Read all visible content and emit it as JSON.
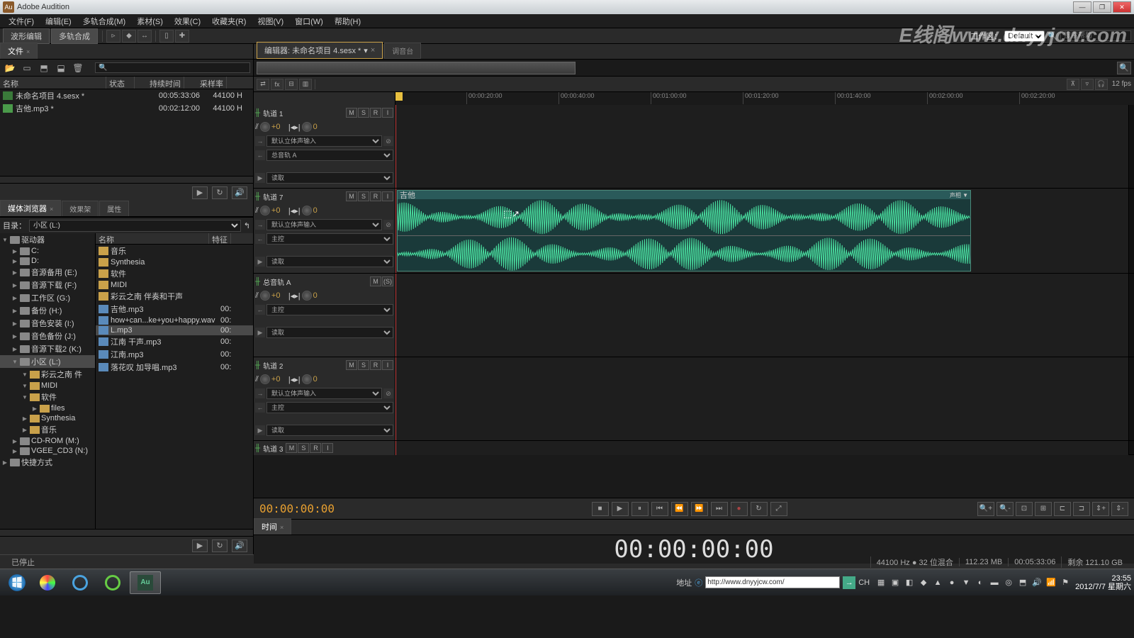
{
  "app": {
    "title": "Adobe Audition",
    "logo": "Au"
  },
  "menu": [
    "文件(F)",
    "编辑(E)",
    "多轨合成(M)",
    "素材(S)",
    "效果(C)",
    "收藏夹(R)",
    "视图(V)",
    "窗口(W)",
    "帮助(H)"
  ],
  "toolbar": {
    "modes": [
      "波形编辑",
      "多轨合成"
    ],
    "workspace_label": "工作区：",
    "workspace": "Default",
    "search_placeholder": "搜索帮助"
  },
  "watermark": "E线阁www.dnyyjcw.com",
  "files_panel": {
    "tab": "文件",
    "search_placeholder": "",
    "headers": {
      "name": "名称",
      "status": "状态",
      "duration": "持续时间",
      "rate": "采样率"
    },
    "rows": [
      {
        "name": "未命名项目 4.sesx *",
        "duration": "00:05:33:06",
        "rate": "44100 H"
      },
      {
        "name": "吉他.mp3 *",
        "duration": "00:02:12:00",
        "rate": "44100 H"
      }
    ]
  },
  "browser_panel": {
    "tabs": [
      "媒体浏览器",
      "效果架",
      "属性"
    ],
    "dir_label": "目录：",
    "dir": "小区 (L:)",
    "tree": [
      {
        "l": 0,
        "t": "drive",
        "n": "驱动器",
        "exp": true
      },
      {
        "l": 1,
        "t": "disk",
        "n": "C:"
      },
      {
        "l": 1,
        "t": "disk",
        "n": "D:"
      },
      {
        "l": 1,
        "t": "disk",
        "n": "音源备用 (E:)"
      },
      {
        "l": 1,
        "t": "disk",
        "n": "音源下载 (F:)"
      },
      {
        "l": 1,
        "t": "disk",
        "n": "工作区 (G:)"
      },
      {
        "l": 1,
        "t": "disk",
        "n": "备份 (H:)"
      },
      {
        "l": 1,
        "t": "disk",
        "n": "音色安装 (I:)"
      },
      {
        "l": 1,
        "t": "disk",
        "n": "音色备份 (J:)"
      },
      {
        "l": 1,
        "t": "disk",
        "n": "音源下载2 (K:)"
      },
      {
        "l": 1,
        "t": "disk",
        "n": "小区 (L:)",
        "exp": true,
        "sel": true
      },
      {
        "l": 2,
        "t": "folder",
        "n": "彩云之南 件",
        "exp": true
      },
      {
        "l": 2,
        "t": "folder",
        "n": "MIDI",
        "exp": true
      },
      {
        "l": 2,
        "t": "folder",
        "n": "软件",
        "exp": true
      },
      {
        "l": 3,
        "t": "folder",
        "n": "files"
      },
      {
        "l": 2,
        "t": "folder",
        "n": "Synthesia"
      },
      {
        "l": 2,
        "t": "folder",
        "n": "音乐"
      },
      {
        "l": 1,
        "t": "disk",
        "n": "CD-ROM (M:)"
      },
      {
        "l": 1,
        "t": "disk",
        "n": "VGEE_CD3 (N:)"
      },
      {
        "l": 0,
        "t": "shortcut",
        "n": "快捷方式"
      }
    ],
    "list_headers": {
      "name": "名称",
      "spec": "特征"
    },
    "list": [
      {
        "type": "folder",
        "name": "音乐"
      },
      {
        "type": "folder",
        "name": "Synthesia"
      },
      {
        "type": "folder",
        "name": "软件"
      },
      {
        "type": "folder",
        "name": "MIDI"
      },
      {
        "type": "folder",
        "name": "彩云之南 伴奏和干声"
      },
      {
        "type": "audio",
        "name": "吉他.mp3",
        "spec": "00:"
      },
      {
        "type": "audio",
        "name": "how+can...ke+you+happy.wav",
        "spec": "00:"
      },
      {
        "type": "audio",
        "name": "L.mp3",
        "spec": "00:",
        "sel": true
      },
      {
        "type": "audio",
        "name": "江南 干声.mp3",
        "spec": "00:"
      },
      {
        "type": "audio",
        "name": "江南.mp3",
        "spec": "00:"
      },
      {
        "type": "audio",
        "name": "落花叹 加导唱.mp3",
        "spec": "00:"
      }
    ]
  },
  "editor": {
    "tabs": [
      {
        "label": "编辑器: 未命名项目 4.sesx *",
        "active": true
      },
      {
        "label": "调音台",
        "active": false
      }
    ],
    "fps": "12 fps",
    "ruler": [
      "00:00:20:00",
      "00:00:40:00",
      "00:01:00:00",
      "00:01:20:00",
      "00:01:40:00",
      "00:02:00:00",
      "00:02:20:00"
    ],
    "clip": {
      "name": "吉他",
      "right_label": "声相 ▼"
    },
    "tracks": [
      {
        "name": "轨道 1",
        "vol": "+0",
        "pan": "0",
        "input": "默认立体声输入",
        "output": "总音轨 A",
        "mode": "读取"
      },
      {
        "name": "轨道 7",
        "vol": "+0",
        "pan": "0",
        "input": "默认立体声输入",
        "output": "主控",
        "mode": "读取",
        "hasClip": true
      },
      {
        "name": "总音轨 A",
        "vol": "+0",
        "pan": "0",
        "output": "主控",
        "mode": "读取",
        "master": true
      },
      {
        "name": "轨道 2",
        "vol": "+0",
        "pan": "0",
        "input": "默认立体声输入",
        "output": "主控",
        "mode": "读取"
      },
      {
        "name": "轨道 3",
        "short": true
      }
    ]
  },
  "transport": {
    "tc": "00:00:00:00"
  },
  "time_panel": {
    "tab": "时间",
    "display": "00:00:00:00"
  },
  "status": {
    "left": "已停止",
    "sample": "44100 Hz ● 32 位混合",
    "mem": "112.23 MB",
    "dur": "00:05:33:06",
    "disk": "剩余 121.10 GB"
  },
  "taskbar": {
    "addr_label": "地址",
    "url": "http://www.dnyyjcw.com/",
    "lang": "CH",
    "clock": {
      "time": "23:55",
      "date": "2012/7/7 星期六"
    }
  }
}
